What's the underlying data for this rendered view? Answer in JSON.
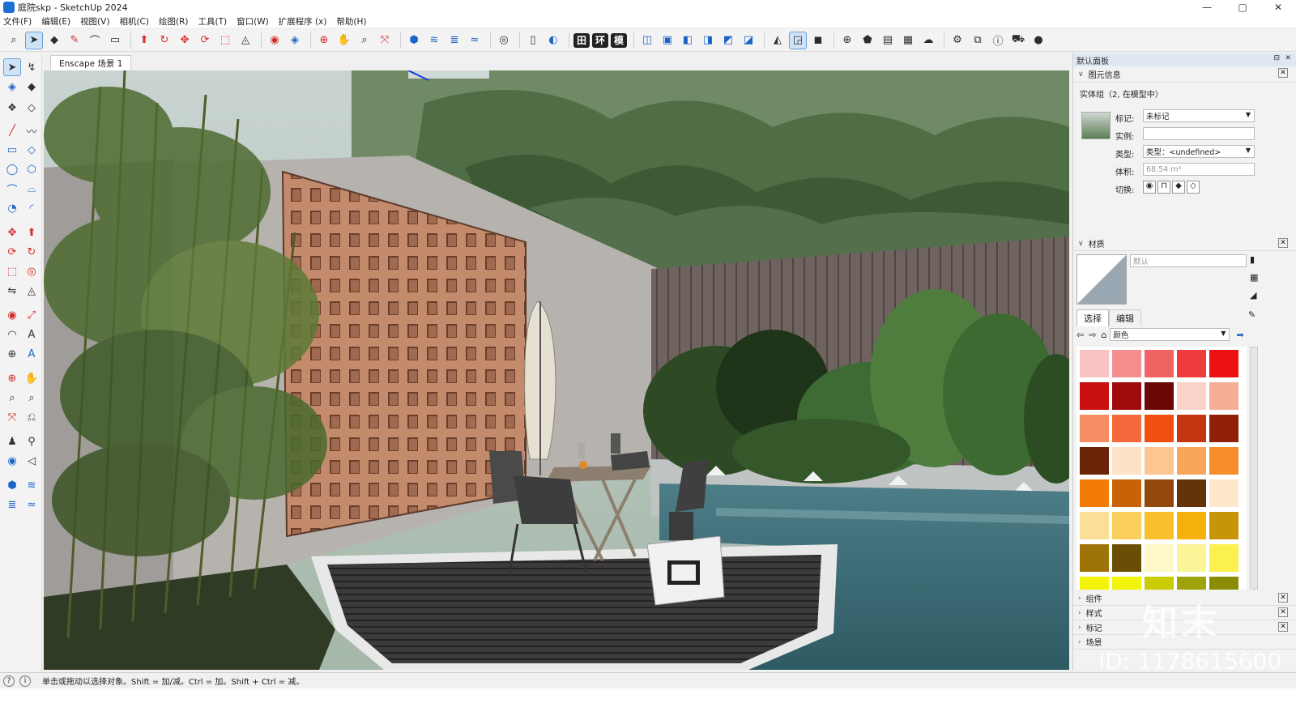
{
  "window": {
    "title": "庭院skp - SketchUp 2024",
    "controls": [
      "—",
      "▢",
      "✕"
    ]
  },
  "menu": [
    "文件(F)",
    "编辑(E)",
    "视图(V)",
    "相机(C)",
    "绘图(R)",
    "工具(T)",
    "窗口(W)",
    "扩展程序 (x)",
    "帮助(H)"
  ],
  "toolbar": {
    "text_buttons": [
      "田",
      "环",
      "模"
    ]
  },
  "scene": {
    "tab_label": "Enscape 场景 1"
  },
  "tray": {
    "title": "默认面板",
    "entity_info": {
      "section_title": "图元信息",
      "summary": "实体组（2, 在模型中）",
      "tag_label": "标记:",
      "tag_value": "未标记",
      "instance_label": "实例:",
      "instance_value": "",
      "type_label": "类型:",
      "type_value": "类型：<undefined>",
      "volume_label": "体积:",
      "volume_value": "68.54 m³",
      "toggle_label": "切换:"
    },
    "materials": {
      "section_title": "材质",
      "name_placeholder": "默认",
      "tab_select": "选择",
      "tab_edit": "编辑",
      "library_value": "颜色",
      "swatches": [
        "#f9c3c3",
        "#f58f8f",
        "#f06363",
        "#ef3b3b",
        "#ee1111",
        "#c90f0f",
        "#a10a0a",
        "#6b0606",
        "#fbd2c7",
        "#f6ad95",
        "#f78d63",
        "#f5683b",
        "#f04f12",
        "#c43510",
        "#8f1f06",
        "#6b2506",
        "#fde2c7",
        "#fcc592",
        "#f9a65a",
        "#f68e2c",
        "#f37c08",
        "#c96106",
        "#94470a",
        "#63340a",
        "#fde9c9",
        "#fcdf97",
        "#fbcf5c",
        "#f8c02a",
        "#f5b20a",
        "#c99508",
        "#9e7408",
        "#6b4e06",
        "#fdf8c7",
        "#fcf597",
        "#fcf050",
        "#f6f30a",
        "#f2f50a",
        "#c9cc06",
        "#a1a30a",
        "#8a8c06"
      ]
    },
    "collapsed_sections": [
      "组件",
      "样式",
      "标记",
      "场景"
    ]
  },
  "status": {
    "message": "单击或拖动以选择对象。Shift = 加/减。Ctrl = 加。Shift + Ctrl = 减。"
  },
  "watermark": {
    "logo": "知末",
    "id": "ID: 1178615600"
  }
}
